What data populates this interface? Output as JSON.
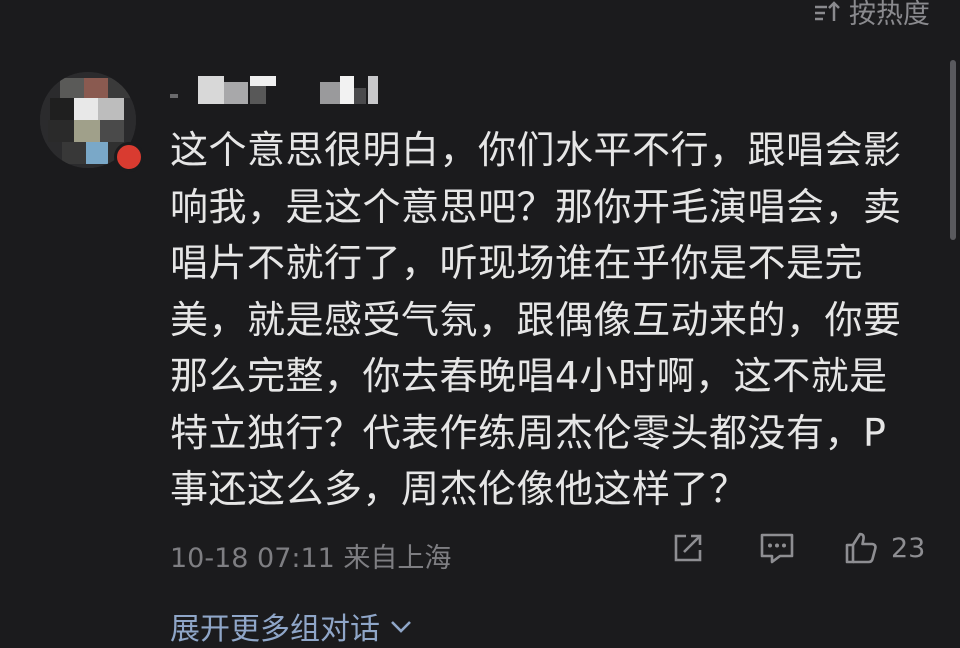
{
  "sort": {
    "label": "按热度",
    "icon": "sort-icon"
  },
  "comment": {
    "text_lines": [
      "这个意思很明白，你们水平不行，跟唱会影",
      "响我，是这个意思吧？那你开毛演唱会，卖",
      "唱片不就行了，听现场谁在乎你是不是完",
      "美，就是感受气氛，跟偶像互动来的，你要",
      "那么完整，你去春晚唱4小时啊，这不就是",
      "特立独行？代表作练周杰伦零头都没有，P",
      "事还这么多，周杰伦像他这样了？"
    ],
    "timestamp": "10-18 07:11 来自上海",
    "likes": "23"
  },
  "actions": {
    "share_icon": "share-icon",
    "reply_icon": "comment-icon",
    "like_icon": "thumbs-up-icon"
  },
  "expand": {
    "label": "展开更多组对话"
  },
  "colors": {
    "background": "#1b1b1d",
    "text": "#e6e6e6",
    "muted": "#7e7e82",
    "link": "#8fa6c8",
    "badge": "#d93b30"
  }
}
